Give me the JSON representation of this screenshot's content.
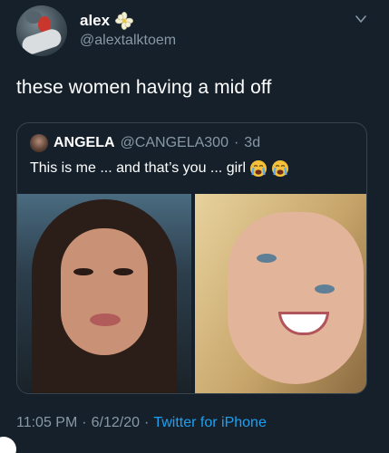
{
  "author": {
    "display_name": "alex",
    "handle": "@alextalktoem",
    "name_emoji": "flower-icon"
  },
  "tweet": {
    "text": "these women having a mid off"
  },
  "quoted": {
    "display_name": "ANGELA",
    "handle": "@CANGELA300",
    "separator": "·",
    "time": "3d",
    "text": "This is me ... and that’s you ... girl",
    "emojis": [
      "crying-face-icon",
      "crying-face-icon"
    ]
  },
  "footer": {
    "time": "11:05 PM",
    "sep1": "·",
    "date": "6/12/20",
    "sep2": "·",
    "source": "Twitter for iPhone"
  },
  "colors": {
    "background": "#15202b",
    "secondary_text": "#8899a6",
    "link": "#1da1f2",
    "border": "#38444d"
  }
}
